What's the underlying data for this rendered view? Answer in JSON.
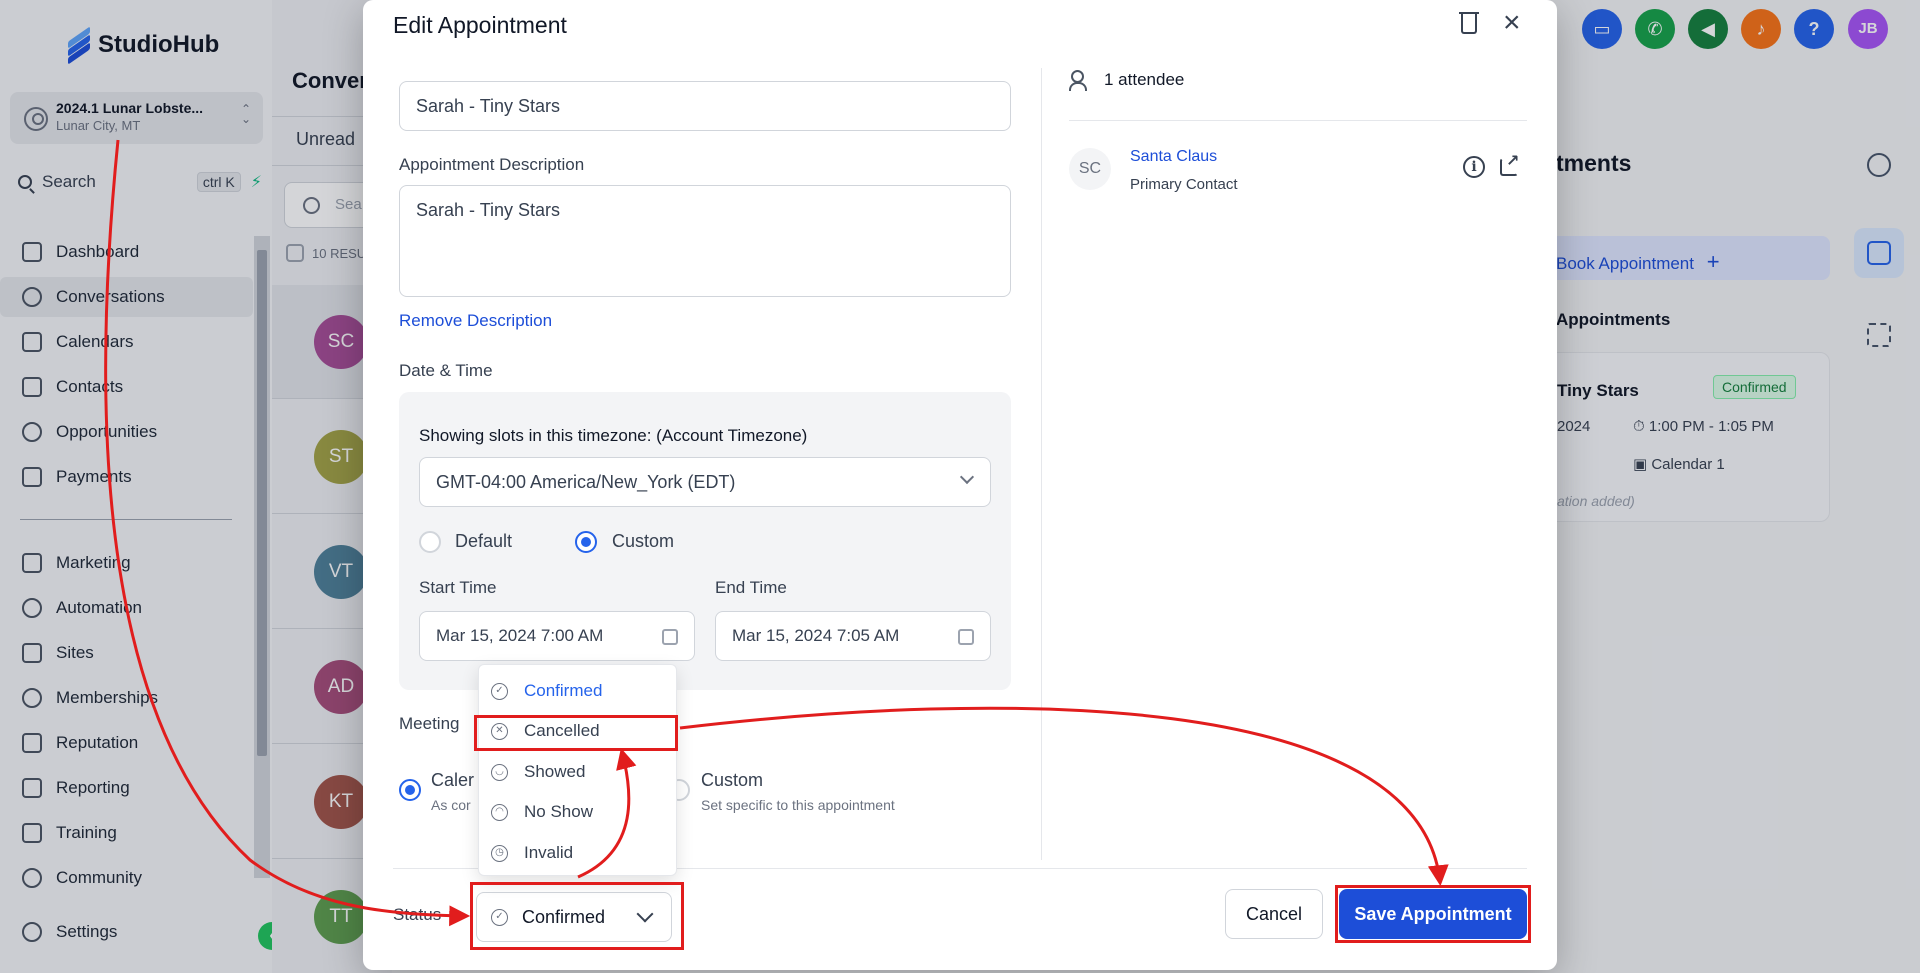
{
  "brand": {
    "name": "StudioHub"
  },
  "location": {
    "name": "2024.1 Lunar Lobste...",
    "sub": "Lunar City, MT"
  },
  "search": {
    "label": "Search",
    "shortcut": "ctrl K"
  },
  "nav": {
    "items": [
      {
        "label": "Dashboard",
        "icon": "dashboard-icon"
      },
      {
        "label": "Conversations",
        "icon": "chat-icon"
      },
      {
        "label": "Calendars",
        "icon": "calendar-icon"
      },
      {
        "label": "Contacts",
        "icon": "contacts-icon"
      },
      {
        "label": "Opportunities",
        "icon": "opportunities-icon"
      },
      {
        "label": "Payments",
        "icon": "payments-icon"
      },
      {
        "label": "Marketing",
        "icon": "send-icon"
      },
      {
        "label": "Automation",
        "icon": "automation-icon"
      },
      {
        "label": "Sites",
        "icon": "sites-icon"
      },
      {
        "label": "Memberships",
        "icon": "memberships-icon"
      },
      {
        "label": "Reputation",
        "icon": "star-icon"
      },
      {
        "label": "Reporting",
        "icon": "chart-icon"
      },
      {
        "label": "Training",
        "icon": "book-icon"
      },
      {
        "label": "Community",
        "icon": "community-icon"
      }
    ],
    "settings": "Settings"
  },
  "conversations": {
    "title": "Conver",
    "tab": "Unread",
    "search_placeholder": "Sea",
    "results": "10 RESU",
    "avatars": [
      {
        "initials": "SC",
        "color": "#a64d96"
      },
      {
        "initials": "ST",
        "color": "#a3a346"
      },
      {
        "initials": "VT",
        "color": "#4f8099"
      },
      {
        "initials": "AD",
        "color": "#a64d7a"
      },
      {
        "initials": "KT",
        "color": "#a1554a"
      },
      {
        "initials": "TT",
        "color": "#5e9e4f"
      }
    ]
  },
  "topbar": {
    "user_initials": "JB"
  },
  "right_panel": {
    "title": "tments",
    "book": "Book Appointment",
    "appointments": "Appointments",
    "card": {
      "title": "Tiny Stars",
      "badge": "Confirmed",
      "date": "2024",
      "time": "1:00 PM - 1:05 PM",
      "calendar": "Calendar 1",
      "note": "ation added)"
    }
  },
  "modal": {
    "title": "Edit Appointment",
    "title_value": "Sarah - Tiny Stars",
    "description_label": "Appointment Description",
    "description_value": "Sarah - Tiny Stars",
    "remove_description": "Remove Description",
    "datetime_label": "Date & Time",
    "tz_caption": "Showing slots in this timezone: (Account Timezone)",
    "tz_value": "GMT-04:00 America/New_York (EDT)",
    "radio_default": "Default",
    "radio_custom": "Custom",
    "start_label": "Start Time",
    "start_value": "Mar 15, 2024 7:00 AM",
    "end_label": "End Time",
    "end_value": "Mar 15, 2024 7:05 AM",
    "meeting_label": "Meeting",
    "meeting_opt1": "Caler",
    "meeting_opt1_sub": "As cor",
    "meeting_opt2": "Custom",
    "meeting_opt2_sub": "Set specific to this appointment",
    "attendees": "1 attendee",
    "contact_initials": "SC",
    "contact_name": "Santa Claus",
    "contact_role": "Primary Contact",
    "status_label": "Status",
    "status_value": "Confirmed",
    "cancel": "Cancel",
    "save": "Save Appointment"
  },
  "status_menu": {
    "options": [
      {
        "label": "Confirmed",
        "icon": "check-circle-icon",
        "selected": true
      },
      {
        "label": "Cancelled",
        "icon": "x-circle-icon",
        "selected": false
      },
      {
        "label": "Showed",
        "icon": "smile-icon",
        "selected": false
      },
      {
        "label": "No Show",
        "icon": "frown-icon",
        "selected": false
      },
      {
        "label": "Invalid",
        "icon": "watch-icon",
        "selected": false
      }
    ]
  },
  "colors": {
    "primary": "#1d4ed8",
    "annotation": "#e11d1d",
    "confirmed_green": "#15803d"
  }
}
